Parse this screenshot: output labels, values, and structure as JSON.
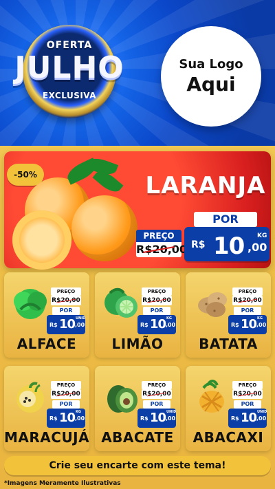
{
  "header": {
    "badge": {
      "top": "OFERTA",
      "main": "JULHO",
      "bottom": "EXCLUSIVA"
    },
    "logo": {
      "line1": "Sua Logo",
      "line2": "Aqui"
    }
  },
  "featured": {
    "discount": "-50%",
    "title": "LARANJA",
    "old": {
      "label": "PREÇO",
      "price": "R$20,00"
    },
    "new": {
      "label": "POR",
      "currency": "R$",
      "amount": "10",
      "cents": ",00",
      "unit": "KG"
    }
  },
  "products": [
    {
      "name": "ALFACE",
      "old_label": "PREÇO",
      "old_price": "R$20,00",
      "por": "POR",
      "currency": "R$",
      "amount": "10",
      "cents": ",00",
      "unit": "UNID"
    },
    {
      "name": "LIMÃO",
      "old_label": "PREÇO",
      "old_price": "R$20,00",
      "por": "POR",
      "currency": "R$",
      "amount": "10",
      "cents": ",00",
      "unit": "KG"
    },
    {
      "name": "BATATA",
      "old_label": "PREÇO",
      "old_price": "R$20,00",
      "por": "POR",
      "currency": "R$",
      "amount": "10",
      "cents": ",00",
      "unit": "KG"
    },
    {
      "name": "MARACUJÁ",
      "old_label": "PREÇO",
      "old_price": "R$20,00",
      "por": "POR",
      "currency": "R$",
      "amount": "10",
      "cents": ",00",
      "unit": "KG"
    },
    {
      "name": "ABACATE",
      "old_label": "PREÇO",
      "old_price": "R$20,00",
      "por": "POR",
      "currency": "R$",
      "amount": "10",
      "cents": ",00",
      "unit": "UNID"
    },
    {
      "name": "ABACAXI",
      "old_label": "PREÇO",
      "old_price": "R$20,00",
      "por": "POR",
      "currency": "R$",
      "amount": "10",
      "cents": ",00",
      "unit": "UNID"
    }
  ],
  "cta": {
    "text": "Crie seu encarte com este tema!"
  },
  "disclaimer": "*Imagens Meramente Ilustrativas"
}
